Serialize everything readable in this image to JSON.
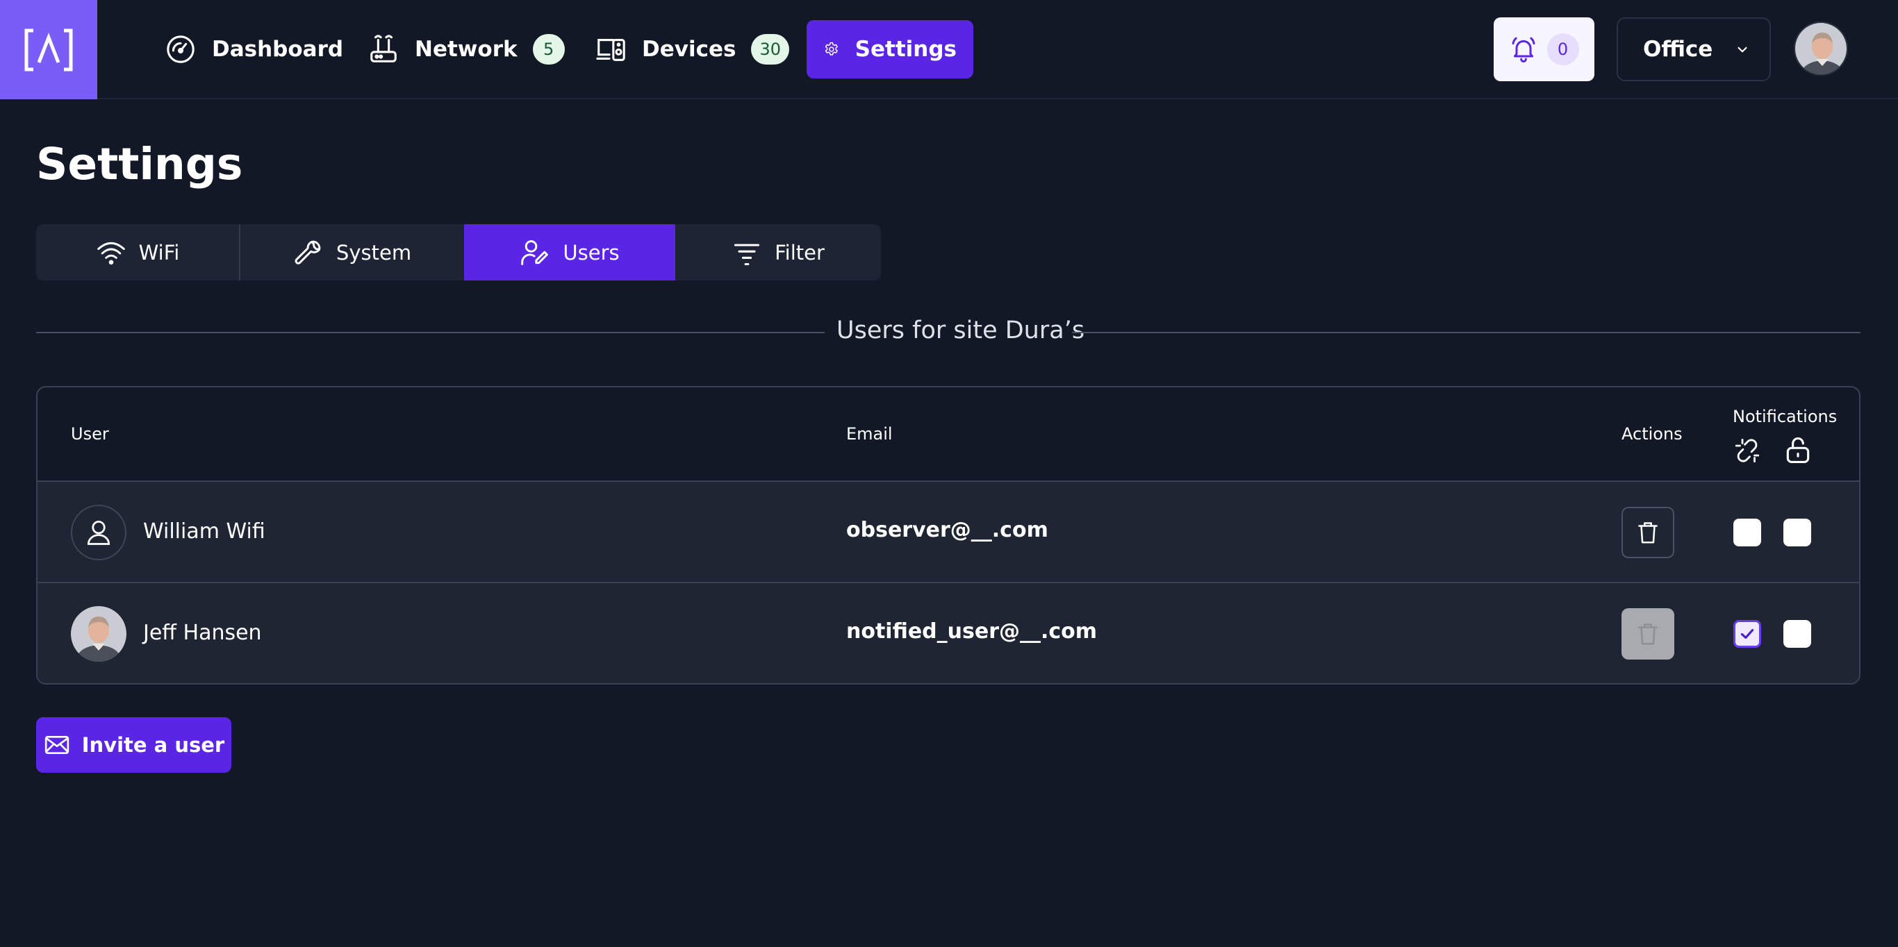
{
  "nav": {
    "items": [
      {
        "label": "Dashboard",
        "icon": "speedometer-icon"
      },
      {
        "label": "Network",
        "icon": "router-icon",
        "badge": "5"
      },
      {
        "label": "Devices",
        "icon": "devices-icon",
        "badge": "30"
      },
      {
        "label": "Settings",
        "icon": "gear-icon",
        "active": true
      }
    ],
    "notifications_count": "0",
    "site_selector": "Office"
  },
  "page": {
    "title": "Settings",
    "tabs": [
      {
        "label": "WiFi",
        "icon": "wifi-icon"
      },
      {
        "label": "System",
        "icon": "wrench-icon"
      },
      {
        "label": "Users",
        "icon": "user-edit-icon",
        "active": true
      },
      {
        "label": "Filter",
        "icon": "filter-icon"
      }
    ],
    "section_title": "Users for site Dura’s"
  },
  "table": {
    "headers": {
      "user": "User",
      "email": "Email",
      "actions": "Actions",
      "notifications": "Notifications"
    },
    "notification_columns": [
      "broken-link-icon",
      "unlock-icon"
    ],
    "rows": [
      {
        "name": "William Wifi",
        "email": "observer@__.com",
        "avatar": "placeholder",
        "delete_enabled": true,
        "notify_link": false,
        "notify_unlock": false
      },
      {
        "name": "Jeff Hansen",
        "email": "notified_user@__.com",
        "avatar": "photo",
        "delete_enabled": false,
        "notify_link": true,
        "notify_unlock": false
      }
    ]
  },
  "actions": {
    "invite_label": "Invite a user"
  },
  "colors": {
    "background": "#131826",
    "accent": "#5b25e6",
    "logo_bg": "#7a5cf6",
    "panel": "#1f2533",
    "badge_bg": "#e3f6e8"
  }
}
